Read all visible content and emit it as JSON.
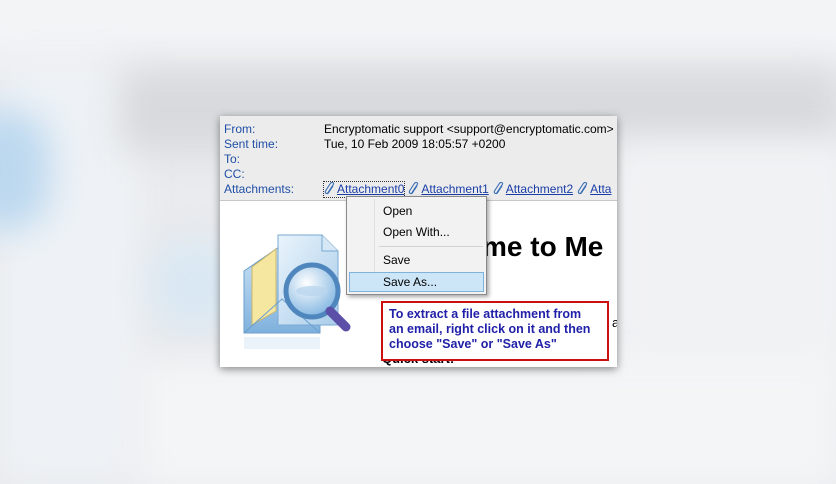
{
  "header": {
    "from_label": "From:",
    "from_value": "Encryptomatic support <support@encryptomatic.com>",
    "sent_label": "Sent time:",
    "sent_value": "Tue, 10 Feb 2009 18:05:57 +0200",
    "to_label": "To:",
    "cc_label": "CC:",
    "attachments_label": "Attachments:",
    "attachments": [
      "Attachment0",
      "Attachment1",
      "Attachment2",
      "Atta"
    ]
  },
  "body": {
    "welcome_fragment": "me to Me",
    "quick_fragment": "Quick start:",
    "stray_char": "a"
  },
  "context_menu": {
    "items": [
      "Open",
      "Open With...",
      "Save",
      "Save As..."
    ],
    "highlighted": "Save As..."
  },
  "callout": {
    "text": "To extract a file attachment from an email, right click on it and then choose \"Save\" or \"Save As\"",
    "line1": "To extract a file attachment from",
    "line2": "an email, right click on it and then",
    "line3": "choose \"Save\" or \"Save As\"",
    "border_color": "#cc1010",
    "text_color": "#2020a8"
  },
  "icons": [
    "paperclip-icon",
    "envelope-magnifier-logo"
  ]
}
